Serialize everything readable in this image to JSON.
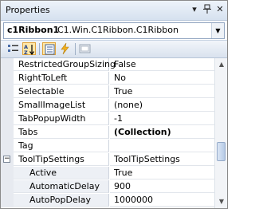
{
  "title": "Properties",
  "title_buttons": {
    "dropdown": "▾",
    "pin": "ᛘ",
    "close": "✕"
  },
  "selector": {
    "name": "c1Ribbon1",
    "type": "C1.Win.C1Ribbon.C1Ribbon"
  },
  "toolbar": {
    "buttons": [
      {
        "icon": "categorized-icon",
        "active": false
      },
      {
        "icon": "alphabetical-sort-icon",
        "active": true
      },
      {
        "icon": "properties-icon",
        "active": true
      },
      {
        "icon": "events-icon",
        "active": false
      },
      {
        "icon": "property-pages-icon",
        "active": false
      }
    ]
  },
  "properties": [
    {
      "name": "RestrictedGroupSizing",
      "value": "False",
      "bold": false
    },
    {
      "name": "RightToLeft",
      "value": "No",
      "bold": false
    },
    {
      "name": "Selectable",
      "value": "True",
      "bold": false
    },
    {
      "name": "SmallImageList",
      "value": "(none)",
      "bold": false
    },
    {
      "name": "TabPopupWidth",
      "value": "-1",
      "bold": false
    },
    {
      "name": "Tabs",
      "value": "(Collection)",
      "bold": true
    },
    {
      "name": "Tag",
      "value": "",
      "bold": false
    },
    {
      "name": "ToolTipSettings",
      "value": "ToolTipSettings",
      "bold": false,
      "expander": "⊟"
    },
    {
      "name": "Active",
      "value": "True",
      "bold": false
    },
    {
      "name": "AutomaticDelay",
      "value": "900",
      "bold": false
    },
    {
      "name": "AutoPopDelay",
      "value": "1000000",
      "bold": false
    }
  ],
  "scrollbar": {
    "up": "▲",
    "down": "▼"
  }
}
